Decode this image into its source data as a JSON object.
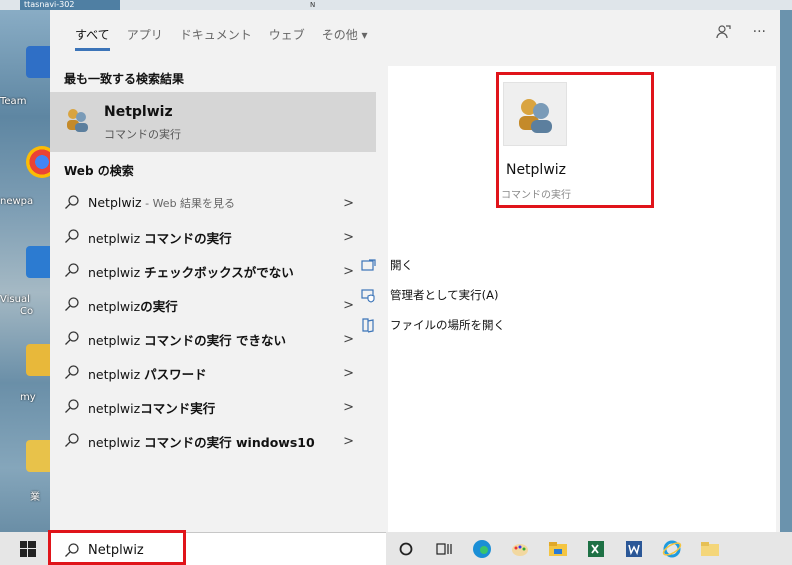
{
  "desktop": {
    "labels": [
      "Team",
      "newpa",
      "Visual",
      "Co",
      "my",
      "業"
    ]
  },
  "topstrip": {
    "tab1": "ttasnavi-302",
    "tab2": "N"
  },
  "header": {
    "tabs": [
      "すべて",
      "アプリ",
      "ドキュメント",
      "ウェブ",
      "その他 ▾"
    ],
    "more_label": "···"
  },
  "best_match": {
    "section_title": "最も一致する検索結果",
    "name": "Netplwiz",
    "sub": "コマンドの実行"
  },
  "web": {
    "section_title": "Web の検索",
    "results": [
      {
        "main": "Netplwiz",
        "bold": "",
        "suffix": " - Web 結果を見る"
      },
      {
        "main": "netplwiz ",
        "bold": "コマンドの実行",
        "suffix": ""
      },
      {
        "main": "netplwiz ",
        "bold": "チェックボックスがでない",
        "suffix": ""
      },
      {
        "main": "netplwiz",
        "bold": "の実行",
        "suffix": ""
      },
      {
        "main": "netplwiz ",
        "bold": "コマンドの実行 できない",
        "suffix": ""
      },
      {
        "main": "netplwiz ",
        "bold": "パスワード",
        "suffix": ""
      },
      {
        "main": "netplwiz",
        "bold": "コマンド実行",
        "suffix": ""
      },
      {
        "main": "netplwiz ",
        "bold": "コマンドの実行 windows10",
        "suffix": ""
      }
    ]
  },
  "detail": {
    "title": "Netplwiz",
    "sub": "コマンドの実行",
    "actions": [
      "開く",
      "管理者として実行(A)",
      "ファイルの場所を開く"
    ]
  },
  "taskbar": {
    "search_value": "Netplwiz"
  },
  "colors": {
    "accent": "#3b74b8",
    "highlight": "#e0141a"
  }
}
